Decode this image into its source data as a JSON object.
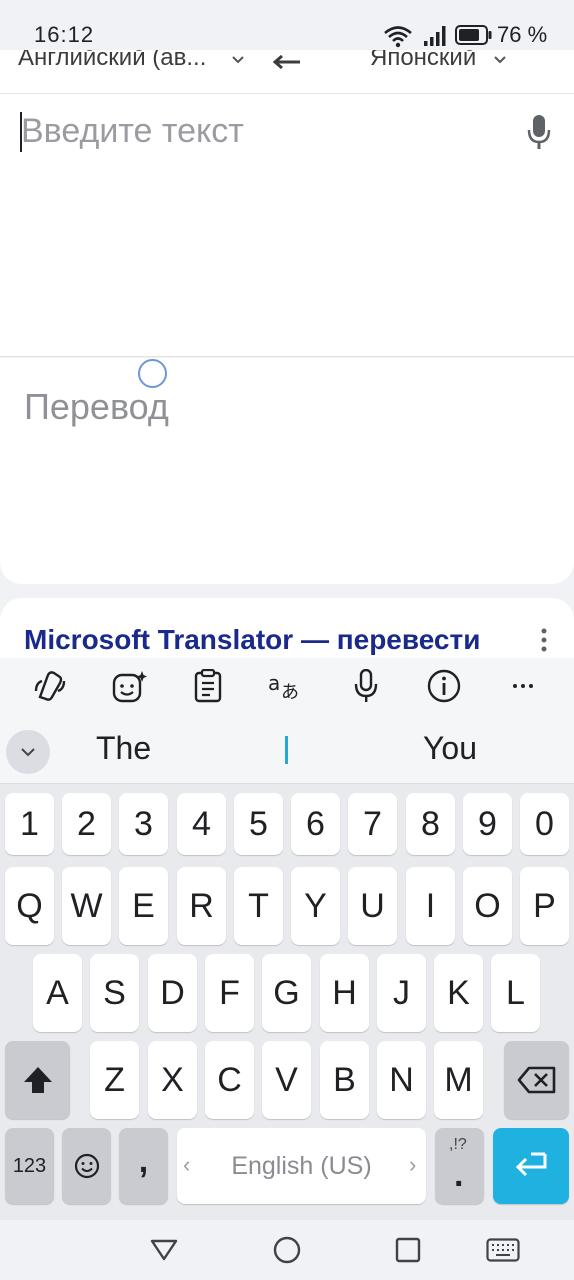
{
  "status_bar": {
    "time": "16:12",
    "battery_percent": "76 %",
    "icons": [
      "wifi-icon",
      "signal-icon",
      "battery-icon"
    ]
  },
  "language_bar": {
    "source": "Английский (ав...",
    "target": "Японский"
  },
  "input": {
    "placeholder": "Введите текст"
  },
  "output": {
    "placeholder": "Перевод"
  },
  "result": {
    "title": "Microsoft Translator — перевести"
  },
  "keyboard": {
    "toolbar_icons": [
      "copilot-icon",
      "sticker-icon",
      "clipboard-icon",
      "translate-icon",
      "mic-icon",
      "info-icon",
      "more-icon"
    ],
    "suggestions": [
      "The",
      "I",
      "You"
    ],
    "row_numbers": [
      "1",
      "2",
      "3",
      "4",
      "5",
      "6",
      "7",
      "8",
      "9",
      "0"
    ],
    "row1": [
      "Q",
      "W",
      "E",
      "R",
      "T",
      "Y",
      "U",
      "I",
      "O",
      "P"
    ],
    "row2": [
      "A",
      "S",
      "D",
      "F",
      "G",
      "H",
      "J",
      "K",
      "L"
    ],
    "row3": [
      "Z",
      "X",
      "C",
      "V",
      "B",
      "N",
      "M"
    ],
    "numbers_key": "123",
    "comma_key": ",",
    "space_label": "English (US)",
    "punct_top": ",!?",
    "punct_main": ".",
    "space_left_arrow": "‹",
    "space_right_arrow": "›"
  },
  "accent_color": "#1fb2e0"
}
